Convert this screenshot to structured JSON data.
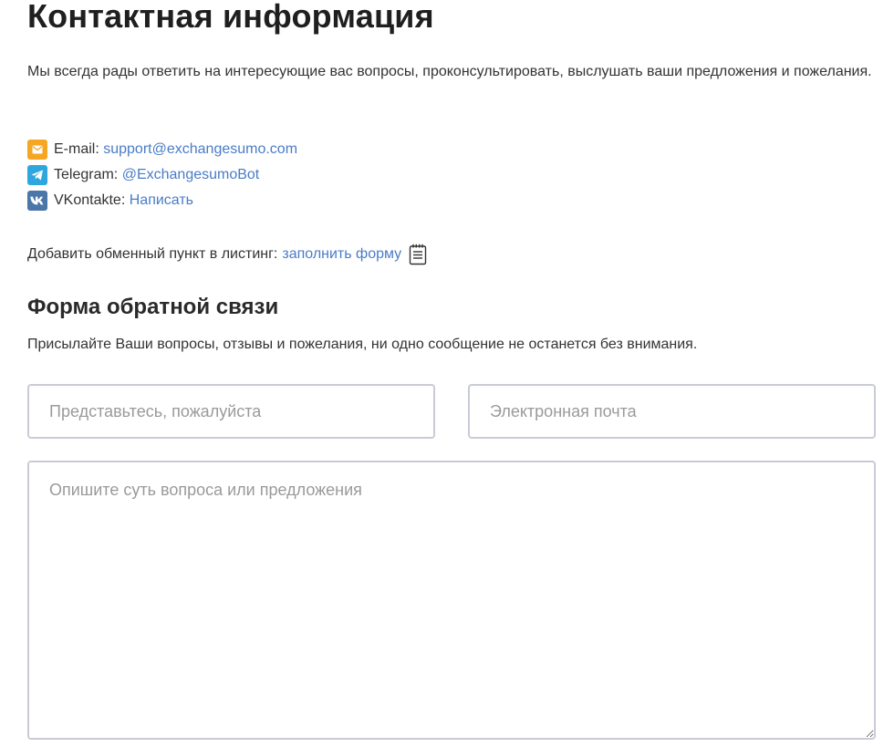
{
  "page": {
    "title": "Контактная информация",
    "intro": "Мы всегда рады ответить на интересующие вас вопросы, проконсультировать, выслушать ваши предложения и пожелания."
  },
  "contacts": {
    "email": {
      "label": "E-mail:",
      "value": "support@exchangesumo.com",
      "icon": "email-icon",
      "color": "#f5a623"
    },
    "telegram": {
      "label": "Telegram:",
      "value": "@ExchangesumoBot",
      "icon": "telegram-icon",
      "color": "#2ea6e0"
    },
    "vk": {
      "label": "VKontakte:",
      "value": "Написать",
      "icon": "vk-icon",
      "color": "#4a76a8"
    }
  },
  "listing": {
    "label": "Добавить обменный пункт в листинг:",
    "link": "заполнить форму",
    "icon": "notepad-icon"
  },
  "feedback": {
    "title": "Форма обратной связи",
    "description": "Присылайте Ваши вопросы, отзывы и пожелания, ни одно сообщение не останется без внимания.",
    "name_placeholder": "Представьтесь, пожалуйста",
    "email_placeholder": "Электронная почта",
    "message_placeholder": "Опишите суть вопроса или предложения"
  },
  "colors": {
    "link": "#4a7cc7",
    "input_border": "#c9ccd6",
    "text": "#333333"
  }
}
